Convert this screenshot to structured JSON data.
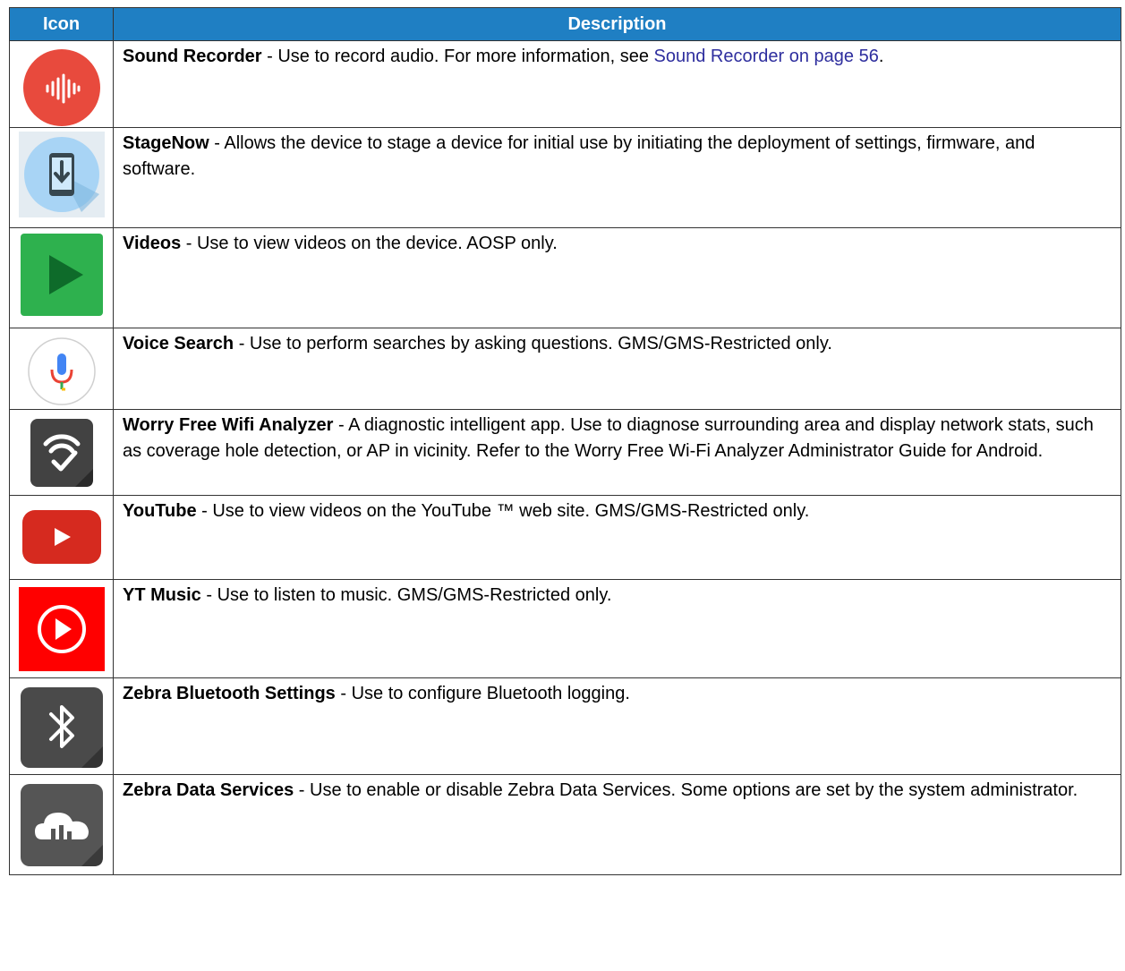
{
  "table": {
    "headers": {
      "icon": "Icon",
      "description": "Description"
    },
    "rows": [
      {
        "icon": "sound-recorder-icon",
        "name": "Sound Recorder",
        "text": " - Use to record audio. For more information, see ",
        "link": "Sound Recorder on page 56",
        "after": "."
      },
      {
        "icon": "stagenow-icon",
        "name": "StageNow",
        "text": " - Allows the device to stage a device for initial use by initiating the deployment of settings, firmware, and software."
      },
      {
        "icon": "videos-icon",
        "name": "Videos",
        "text": " - Use to view videos on the device. AOSP only."
      },
      {
        "icon": "voice-search-icon",
        "name": "Voice Search",
        "text": " - Use to perform searches by asking questions. GMS/GMS-Restricted only."
      },
      {
        "icon": "worry-free-wifi-analyzer-icon",
        "name": "Worry Free Wifi Analyzer",
        "text": " - A diagnostic intelligent app. Use to diagnose surrounding area and display network stats, such as coverage hole detection, or AP in vicinity. Refer to the Worry Free Wi-Fi Analyzer Administrator Guide for Android."
      },
      {
        "icon": "youtube-icon",
        "name": "YouTube",
        "text": " - Use to view videos on the YouTube ™ web site. GMS/GMS-Restricted only."
      },
      {
        "icon": "yt-music-icon",
        "name": "YT Music",
        "text": " - Use to listen to music. GMS/GMS-Restricted only."
      },
      {
        "icon": "bluetooth-icon",
        "name": "Zebra Bluetooth Settings",
        "text": " - Use to configure Bluetooth logging."
      },
      {
        "icon": "zebra-data-services-icon",
        "name": "Zebra Data Services",
        "text": " - Use to enable or disable Zebra Data Services. Some options are set by the system administrator."
      }
    ]
  },
  "colors": {
    "header_bg": "#1f7fc3",
    "link": "#2e2e9e"
  }
}
